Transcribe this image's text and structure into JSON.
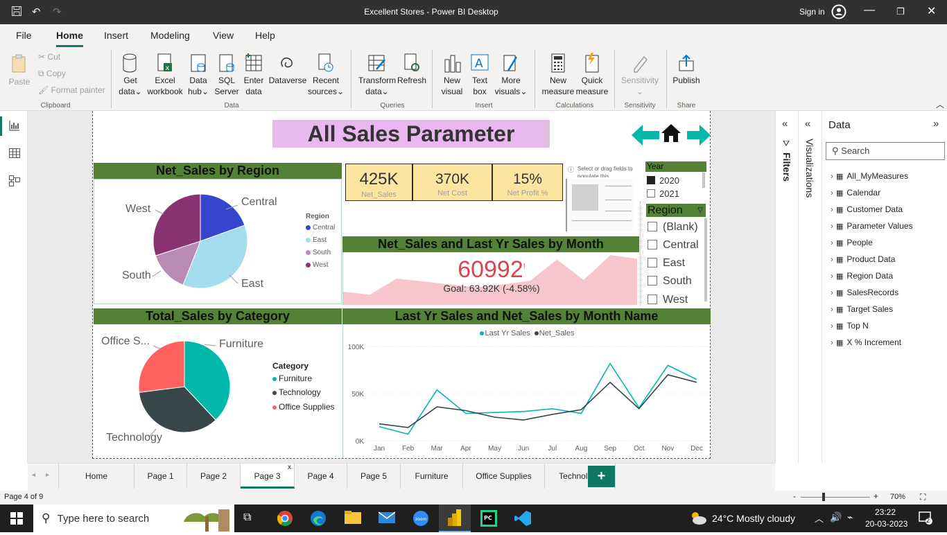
{
  "window": {
    "title": "Excellent Stores - Power BI Desktop",
    "sign_in": "Sign in"
  },
  "menu": {
    "items": [
      "File",
      "Home",
      "Insert",
      "Modeling",
      "View",
      "Help"
    ],
    "active": "Home"
  },
  "ribbon": {
    "clipboard": {
      "paste": "Paste",
      "cut": "Cut",
      "copy": "Copy",
      "format_painter": "Format painter",
      "group": "Clipboard"
    },
    "data": {
      "get_data": [
        "Get",
        "data"
      ],
      "excel": [
        "Excel",
        "workbook"
      ],
      "data_hub": [
        "Data",
        "hub"
      ],
      "sql": [
        "SQL",
        "Server"
      ],
      "enter": [
        "Enter",
        "data"
      ],
      "dataverse": "Dataverse",
      "recent": [
        "Recent",
        "sources"
      ],
      "group": "Data"
    },
    "queries": {
      "transform": [
        "Transform",
        "data"
      ],
      "refresh": "Refresh",
      "group": "Queries"
    },
    "insert": {
      "new_visual": [
        "New",
        "visual"
      ],
      "text_box": [
        "Text",
        "box"
      ],
      "more_visuals": [
        "More",
        "visuals"
      ],
      "group": "Insert"
    },
    "calculations": {
      "new_measure": [
        "New",
        "measure"
      ],
      "quick_measure": [
        "Quick",
        "measure"
      ],
      "group": "Calculations"
    },
    "sensitivity": {
      "label": "Sensitivity",
      "group": "Sensitivity"
    },
    "share": {
      "publish": "Publish",
      "group": "Share"
    }
  },
  "report": {
    "title": "All Sales Parameter",
    "region_chart": {
      "header": "Net_Sales by Region",
      "legend_title": "Region",
      "labels": [
        "Central",
        "East",
        "South",
        "West"
      ],
      "colors": [
        "#3545cc",
        "#a3dbef",
        "#b98bb4",
        "#8a3373"
      ]
    },
    "cards": [
      {
        "value": "425K",
        "label": "Net_Sales"
      },
      {
        "value": "370K",
        "label": "Net Cost"
      },
      {
        "value": "15%",
        "label": "Net Profit %"
      }
    ],
    "placeholder": {
      "text": "Select or drag fields to populate this"
    },
    "year_slicer": {
      "header": "Year",
      "items": [
        "2020",
        "2021"
      ]
    },
    "region_slicer": {
      "header": "Region",
      "items": [
        "(Blank)",
        "Central",
        "East",
        "South",
        "West"
      ]
    },
    "kpi": {
      "header": "Net_Sales and Last Yr Sales by Month",
      "value": "60992",
      "mark": "!",
      "goal": "Goal: 63.92K (-4.58%)"
    },
    "category_chart": {
      "header": "Total_Sales by Category",
      "legend_title": "Category",
      "labels": [
        "Furniture",
        "Technology",
        "Office Supplies"
      ],
      "slice_labels": [
        "Furniture",
        "Technology",
        "Office S..."
      ],
      "colors": [
        "#01b8aa",
        "#374649",
        "#fd625e"
      ]
    },
    "line_chart": {
      "header": "Last Yr Sales and Net_Sales by Month Name",
      "legend": [
        "Last Yr Sales",
        "Net_Sales"
      ],
      "colors": [
        "#01b8aa",
        "#374649"
      ]
    }
  },
  "chart_data": [
    {
      "type": "pie",
      "title": "Net_Sales by Region",
      "legend_title": "Region",
      "categories": [
        "Central",
        "East",
        "South",
        "West"
      ],
      "values": [
        19.5,
        36.5,
        14,
        30
      ]
    },
    {
      "type": "pie",
      "title": "Total_Sales by Category",
      "legend_title": "Category",
      "categories": [
        "Furniture",
        "Technology",
        "Office Supplies"
      ],
      "values": [
        38,
        35,
        27
      ]
    },
    {
      "type": "area",
      "title": "Net_Sales and Last Yr Sales by Month",
      "categories": [
        "Jan",
        "Feb",
        "Mar",
        "Apr",
        "May",
        "Jun",
        "Jul",
        "Aug",
        "Sep",
        "Oct",
        "Nov",
        "Dec"
      ],
      "values": [
        18,
        14,
        36,
        32,
        28,
        24,
        28,
        33,
        62,
        34,
        68,
        63
      ]
    },
    {
      "type": "line",
      "title": "Last Yr Sales and Net_Sales by Month Name",
      "categories": [
        "Jan",
        "Feb",
        "Mar",
        "Apr",
        "May",
        "Jun",
        "Jul",
        "Aug",
        "Sep",
        "Oct",
        "Nov",
        "Dec"
      ],
      "series": [
        {
          "name": "Last Yr Sales",
          "values": [
            15,
            7,
            54,
            29,
            30,
            31,
            34,
            29,
            82,
            35,
            80,
            65
          ]
        },
        {
          "name": "Net_Sales",
          "values": [
            18,
            14,
            36,
            32,
            25,
            22,
            28,
            33,
            62,
            34,
            70,
            62
          ]
        }
      ],
      "yticks": [
        "0K",
        "50K",
        "100K"
      ],
      "ylim": [
        0,
        100
      ]
    }
  ],
  "filters": {
    "label": "Filters"
  },
  "visualizations": {
    "label": "Visualizations"
  },
  "data_pane": {
    "title": "Data",
    "search_placeholder": "Search",
    "fields": [
      "All_MyMeasures",
      "Calendar",
      "Customer Data",
      "Parameter Values",
      "People",
      "Product Data",
      "Region Data",
      "SalesRecords",
      "Target Sales",
      "Top N",
      "X % Increment"
    ]
  },
  "tabs": {
    "items": [
      "Home",
      "Page 1",
      "Page 2",
      "Page 3",
      "Page 4",
      "Page 5",
      "Furniture",
      "Office Supplies",
      "Technology"
    ],
    "active": "Page 3",
    "add": "+",
    "close": "x"
  },
  "status": {
    "page": "Page 4 of 9",
    "zoom": "70%"
  },
  "taskbar": {
    "search": "Type here to search",
    "weather": "24°C  Mostly cloudy",
    "time": "23:22",
    "date": "20-03-2023",
    "notifications": "2"
  }
}
